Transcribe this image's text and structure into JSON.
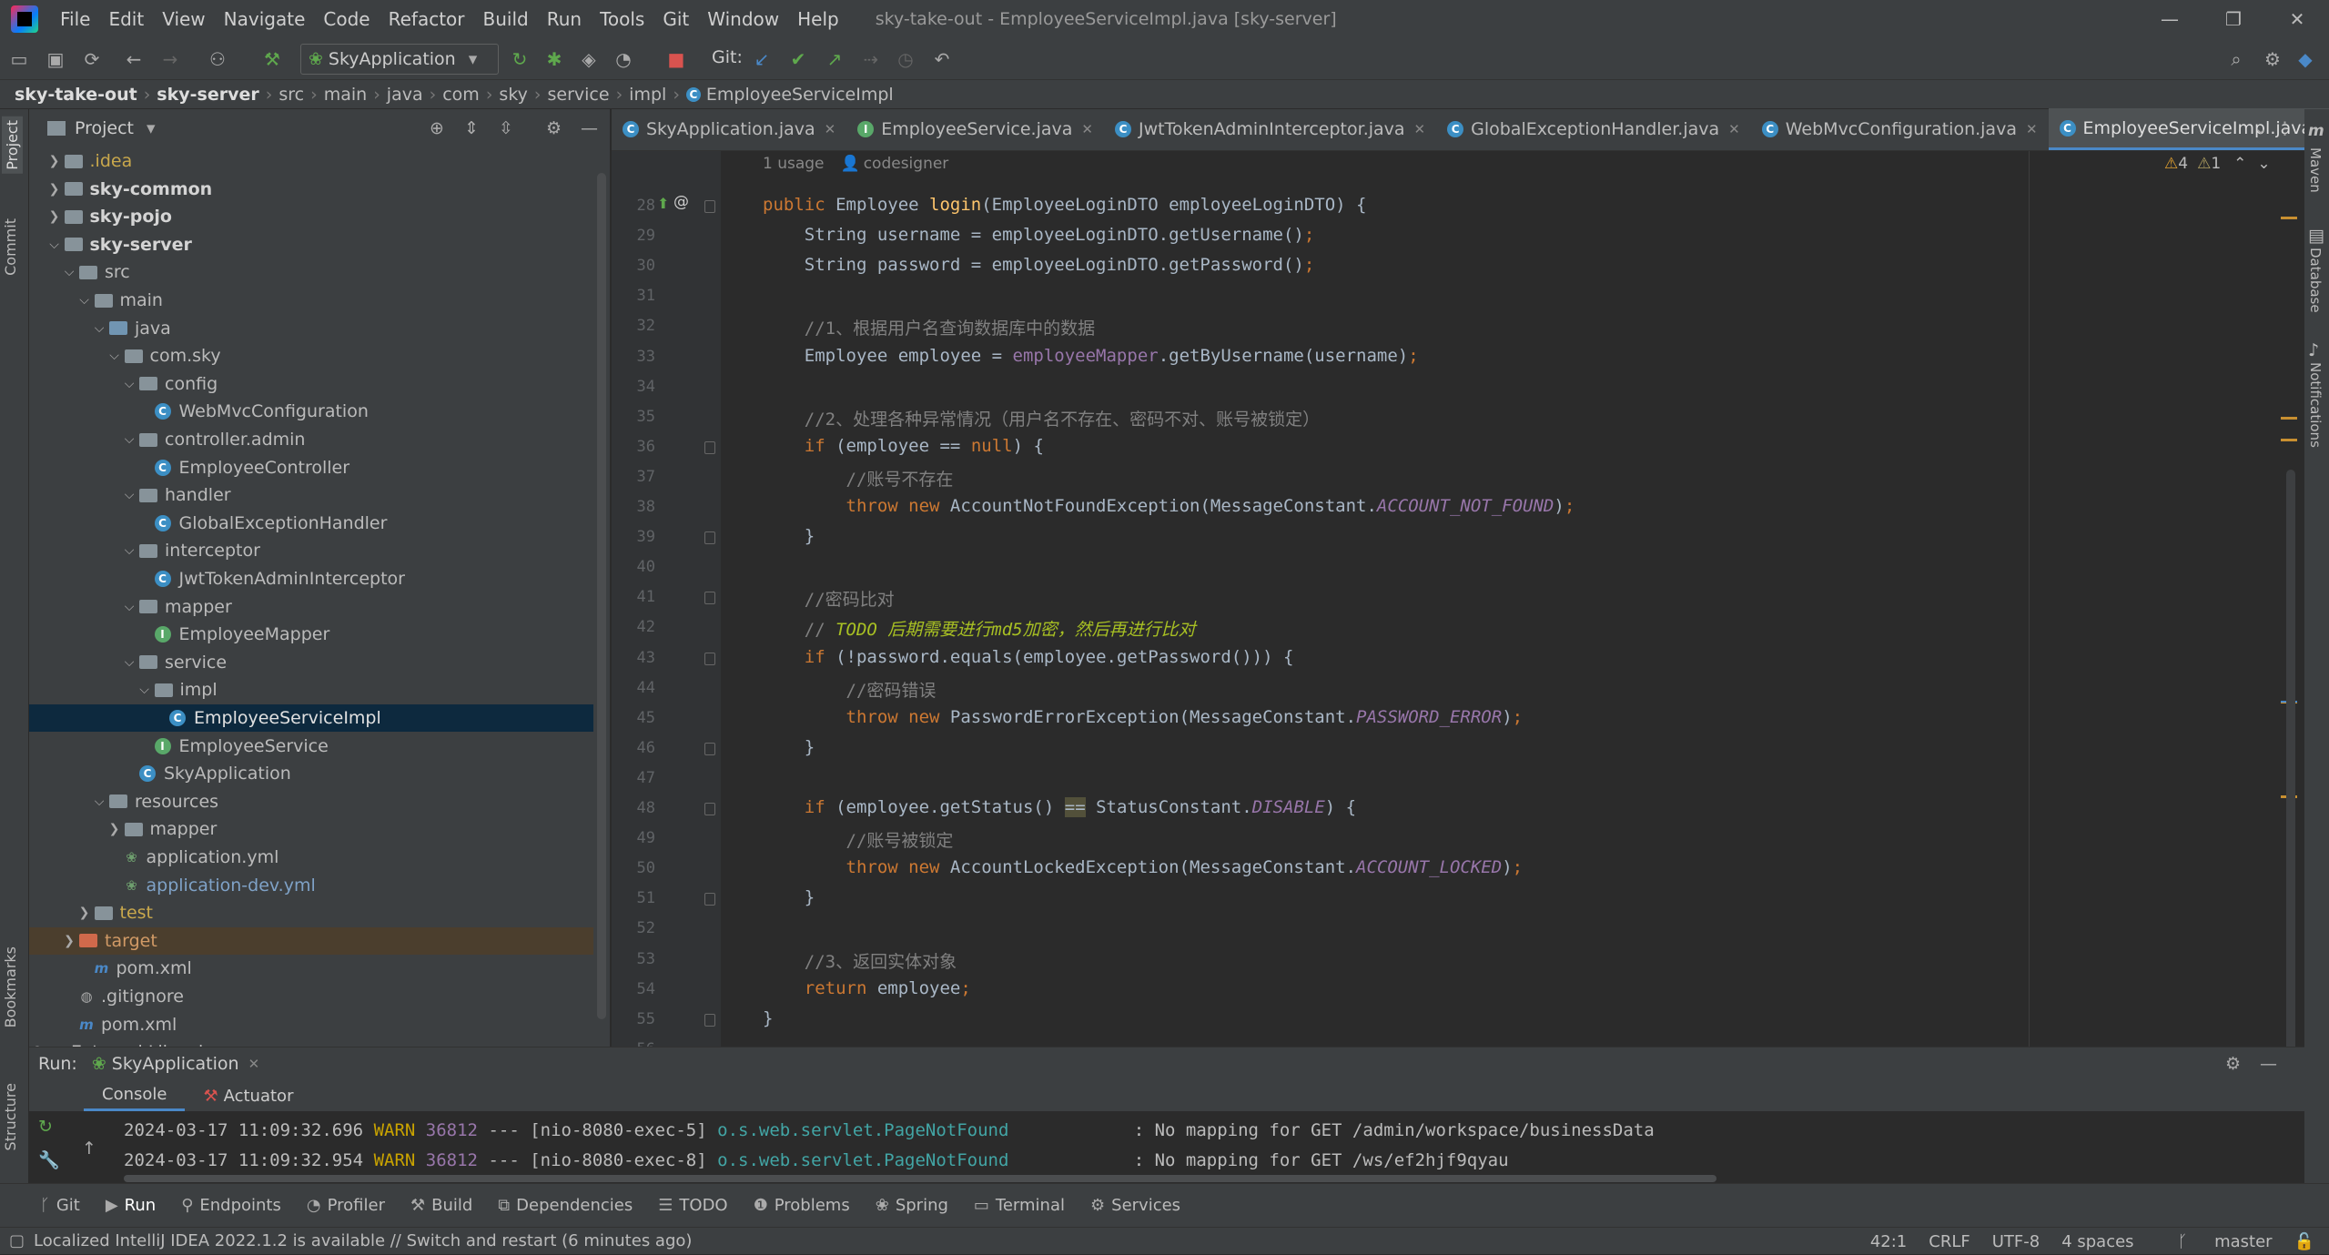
{
  "window": {
    "title": "sky-take-out - EmployeeServiceImpl.java [sky-server]",
    "menu": [
      "File",
      "Edit",
      "View",
      "Navigate",
      "Code",
      "Refactor",
      "Build",
      "Run",
      "Tools",
      "Git",
      "Window",
      "Help"
    ]
  },
  "toolbar": {
    "run_config": "SkyApplication",
    "git_label": "Git:"
  },
  "breadcrumb": [
    "sky-take-out",
    "sky-server",
    "src",
    "main",
    "java",
    "com",
    "sky",
    "service",
    "impl",
    "EmployeeServiceImpl"
  ],
  "left_strip": {
    "project": "Project",
    "commit": "Commit",
    "bookmarks": "Bookmarks",
    "structure": "Structure"
  },
  "right_strip": {
    "maven": "Maven",
    "database": "Database",
    "notifications": "Notifications"
  },
  "project": {
    "title": "Project",
    "tree": [
      {
        "label": ".idea",
        "kind": "folder",
        "style": "idea",
        "depth": 1,
        "arrow": "›"
      },
      {
        "label": "sky-common",
        "kind": "module",
        "style": "bold",
        "depth": 1,
        "arrow": "›"
      },
      {
        "label": "sky-pojo",
        "kind": "module",
        "style": "bold",
        "depth": 1,
        "arrow": "›"
      },
      {
        "label": "sky-server",
        "kind": "module",
        "style": "bold",
        "depth": 1,
        "arrow": "⌄"
      },
      {
        "label": "src",
        "kind": "folder",
        "style": "",
        "depth": 2,
        "arrow": "⌄"
      },
      {
        "label": "main",
        "kind": "folder",
        "style": "",
        "depth": 3,
        "arrow": "⌄"
      },
      {
        "label": "java",
        "kind": "folder-blue",
        "style": "",
        "depth": 4,
        "arrow": "⌄"
      },
      {
        "label": "com.sky",
        "kind": "folder",
        "style": "",
        "depth": 5,
        "arrow": "⌄"
      },
      {
        "label": "config",
        "kind": "folder",
        "style": "",
        "depth": 6,
        "arrow": "⌄"
      },
      {
        "label": "WebMvcConfiguration",
        "kind": "class",
        "style": "",
        "depth": 7,
        "arrow": ""
      },
      {
        "label": "controller.admin",
        "kind": "folder",
        "style": "",
        "depth": 6,
        "arrow": "⌄"
      },
      {
        "label": "EmployeeController",
        "kind": "class",
        "style": "",
        "depth": 7,
        "arrow": ""
      },
      {
        "label": "handler",
        "kind": "folder",
        "style": "",
        "depth": 6,
        "arrow": "⌄"
      },
      {
        "label": "GlobalExceptionHandler",
        "kind": "class",
        "style": "",
        "depth": 7,
        "arrow": ""
      },
      {
        "label": "interceptor",
        "kind": "folder",
        "style": "",
        "depth": 6,
        "arrow": "⌄"
      },
      {
        "label": "JwtTokenAdminInterceptor",
        "kind": "class",
        "style": "",
        "depth": 7,
        "arrow": ""
      },
      {
        "label": "mapper",
        "kind": "folder",
        "style": "",
        "depth": 6,
        "arrow": "⌄"
      },
      {
        "label": "EmployeeMapper",
        "kind": "interface",
        "style": "",
        "depth": 7,
        "arrow": ""
      },
      {
        "label": "service",
        "kind": "folder",
        "style": "",
        "depth": 6,
        "arrow": "⌄"
      },
      {
        "label": "impl",
        "kind": "folder",
        "style": "",
        "depth": 7,
        "arrow": "⌄"
      },
      {
        "label": "EmployeeServiceImpl",
        "kind": "class",
        "style": "sel",
        "depth": 8,
        "arrow": ""
      },
      {
        "label": "EmployeeService",
        "kind": "interface",
        "style": "",
        "depth": 7,
        "arrow": ""
      },
      {
        "label": "SkyApplication",
        "kind": "class",
        "style": "",
        "depth": 6,
        "arrow": ""
      },
      {
        "label": "resources",
        "kind": "folder",
        "style": "",
        "depth": 4,
        "arrow": "⌄"
      },
      {
        "label": "mapper",
        "kind": "folder",
        "style": "",
        "depth": 5,
        "arrow": "›"
      },
      {
        "label": "application.yml",
        "kind": "yml",
        "style": "",
        "depth": 5,
        "arrow": ""
      },
      {
        "label": "application-dev.yml",
        "kind": "yml",
        "style": "blue",
        "depth": 5,
        "arrow": ""
      },
      {
        "label": "test",
        "kind": "folder",
        "style": "idea",
        "depth": 3,
        "arrow": "›"
      },
      {
        "label": "target",
        "kind": "folder-orange",
        "style": "target",
        "depth": 2,
        "arrow": "›"
      },
      {
        "label": "pom.xml",
        "kind": "maven",
        "style": "",
        "depth": 3,
        "arrow": ""
      },
      {
        "label": ".gitignore",
        "kind": "git",
        "style": "",
        "depth": 2,
        "arrow": ""
      },
      {
        "label": "pom.xml",
        "kind": "maven",
        "style": "",
        "depth": 2,
        "arrow": ""
      },
      {
        "label": "External Libraries",
        "kind": "lib",
        "style": "",
        "depth": 0,
        "arrow": "›"
      }
    ]
  },
  "tabs": [
    {
      "label": "SkyApplication.java",
      "active": false
    },
    {
      "label": "EmployeeService.java",
      "active": false
    },
    {
      "label": "JwtTokenAdminInterceptor.java",
      "active": false
    },
    {
      "label": "GlobalExceptionHandler.java",
      "active": false
    },
    {
      "label": "WebMvcConfiguration.java",
      "active": false
    },
    {
      "label": "EmployeeServiceImpl.java",
      "active": true
    }
  ],
  "editor": {
    "usage_hint": "1 usage",
    "author_hint": "codesigner",
    "warnings": "4",
    "weak_warnings": "1",
    "lines": [
      {
        "n": "28",
        "html": "<span class='kw'>public</span> Employee <span class='fn'>login</span>(EmployeeLoginDTO employeeLoginDTO) {"
      },
      {
        "n": "29",
        "html": "    String username = employeeLoginDTO.getUsername()<span class='kw'>;</span>"
      },
      {
        "n": "30",
        "html": "    String password = employeeLoginDTO.getPassword()<span class='kw'>;</span>"
      },
      {
        "n": "31",
        "html": ""
      },
      {
        "n": "32",
        "html": "    <span class='cm'>//1、根据用户名查询数据库中的数据</span>"
      },
      {
        "n": "33",
        "html": "    Employee employee = <span class='fld'>employeeMapper</span>.getByUsername(username)<span class='kw'>;</span>"
      },
      {
        "n": "34",
        "html": ""
      },
      {
        "n": "35",
        "html": "    <span class='cm'>//2、处理各种异常情况（用户名不存在、密码不对、账号被锁定）</span>"
      },
      {
        "n": "36",
        "html": "    <span class='kw'>if</span> (employee == <span class='kw'>null</span>) {"
      },
      {
        "n": "37",
        "html": "        <span class='cm'>//账号不存在</span>"
      },
      {
        "n": "38",
        "html": "        <span class='kw'>throw new</span> AccountNotFoundException(MessageConstant.<span class='ital'>ACCOUNT_NOT_FOUND</span>)<span class='kw'>;</span>"
      },
      {
        "n": "39",
        "html": "    }"
      },
      {
        "n": "40",
        "html": ""
      },
      {
        "n": "41",
        "html": "    <span class='cm'>//密码比对</span>"
      },
      {
        "n": "42",
        "html": "    <span class='cm'>// </span><span class='todo'>TODO 后期需要进行md5加密，然后再进行比对</span>"
      },
      {
        "n": "43",
        "html": "    <span class='kw'>if</span> (!password.equals(employee.getPassword())) {"
      },
      {
        "n": "44",
        "html": "        <span class='cm'>//密码错误</span>"
      },
      {
        "n": "45",
        "html": "        <span class='kw'>throw new</span> PasswordErrorException(MessageConstant.<span class='ital'>PASSWORD_ERROR</span>)<span class='kw'>;</span>"
      },
      {
        "n": "46",
        "html": "    }"
      },
      {
        "n": "47",
        "html": ""
      },
      {
        "n": "48",
        "html": "    <span class='kw'>if</span> (employee.getStatus() <span style='background:#52503a'>==</span> StatusConstant.<span class='ital'>DISABLE</span>) {"
      },
      {
        "n": "49",
        "html": "        <span class='cm'>//账号被锁定</span>"
      },
      {
        "n": "50",
        "html": "        <span class='kw'>throw new</span> AccountLockedException(MessageConstant.<span class='ital'>ACCOUNT_LOCKED</span>)<span class='kw'>;</span>"
      },
      {
        "n": "51",
        "html": "    }"
      },
      {
        "n": "52",
        "html": ""
      },
      {
        "n": "53",
        "html": "    <span class='cm'>//3、返回实体对象</span>"
      },
      {
        "n": "54",
        "html": "    <span class='kw'>return</span> employee<span class='kw'>;</span>"
      },
      {
        "n": "55",
        "html": "}"
      },
      {
        "n": "56",
        "html": ""
      }
    ]
  },
  "run": {
    "label": "Run:",
    "config": "SkyApplication",
    "tabs": [
      "Console",
      "Actuator"
    ],
    "log": [
      {
        "ts": "2024-03-17 11:09:32.696",
        "level": "WARN",
        "pid": "36812",
        "sep": "---",
        "thread": "[nio-8080-exec-5]",
        "logger": "o.s.web.servlet.PageNotFound",
        "msg": ": No mapping for GET /admin/workspace/businessData"
      },
      {
        "ts": "2024-03-17 11:09:32.954",
        "level": "WARN",
        "pid": "36812",
        "sep": "---",
        "thread": "[nio-8080-exec-8]",
        "logger": "o.s.web.servlet.PageNotFound",
        "msg": ": No mapping for GET /ws/ef2hjf9qyau"
      }
    ]
  },
  "toolwindows": [
    {
      "label": "Git",
      "icon": "git-icon"
    },
    {
      "label": "Run",
      "icon": "run-icon"
    },
    {
      "label": "Endpoints",
      "icon": "endpoints-icon"
    },
    {
      "label": "Profiler",
      "icon": "profiler-icon"
    },
    {
      "label": "Build",
      "icon": "build-icon"
    },
    {
      "label": "Dependencies",
      "icon": "dependencies-icon"
    },
    {
      "label": "TODO",
      "icon": "todo-icon"
    },
    {
      "label": "Problems",
      "icon": "problems-icon"
    },
    {
      "label": "Spring",
      "icon": "spring-icon"
    },
    {
      "label": "Terminal",
      "icon": "terminal-icon"
    },
    {
      "label": "Services",
      "icon": "services-icon"
    }
  ],
  "status": {
    "message": "Localized IntelliJ IDEA 2022.1.2 is available // Switch and restart (6 minutes ago)",
    "position": "42:1",
    "line_sep": "CRLF",
    "encoding": "UTF-8",
    "indent": "4 spaces",
    "branch": "master"
  }
}
